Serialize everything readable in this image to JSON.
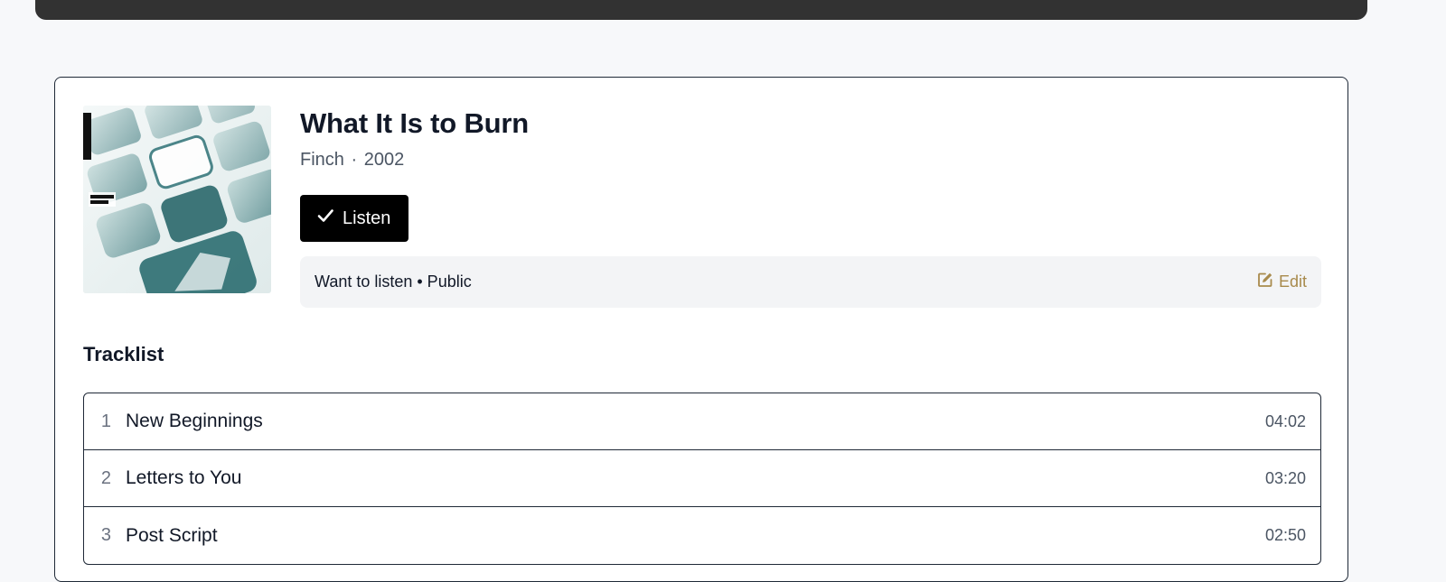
{
  "album": {
    "title": "What It Is to Burn",
    "artist": "Finch",
    "separator": "·",
    "year": "2002",
    "cover_alt": "What It Is to Burn album cover"
  },
  "actions": {
    "listen_label": "Listen",
    "listen_icon": "check-icon",
    "status_text": "Want to listen • Public",
    "edit_label": "Edit",
    "edit_icon": "edit-icon"
  },
  "tracklist": {
    "heading": "Tracklist",
    "tracks": [
      {
        "number": "1",
        "title": "New Beginnings",
        "duration": "04:02"
      },
      {
        "number": "2",
        "title": "Letters to You",
        "duration": "03:20"
      },
      {
        "number": "3",
        "title": "Post Script",
        "duration": "02:50"
      }
    ]
  },
  "colors": {
    "accent_edit": "#a88a4c",
    "button_bg": "#000000",
    "topbar": "#323232",
    "status_bg": "#f3f4f6"
  }
}
